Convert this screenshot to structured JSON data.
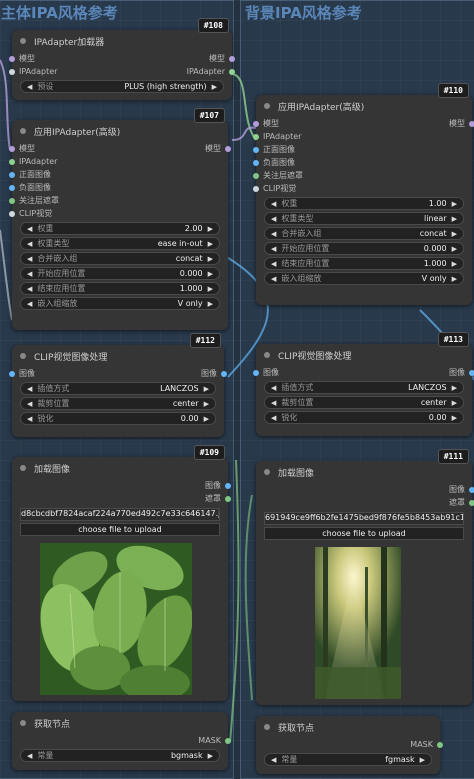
{
  "groups": {
    "left_title": "主体IPA风格参考",
    "right_title": "背景IPA风格参考"
  },
  "colors": {
    "canvas": "#243240",
    "node": "#353535",
    "group_title": "#5b86b8",
    "model_slot": "#b39ddb",
    "ipadapter_slot": "#8fd18f",
    "image_slot": "#64b5f6",
    "mask_slot": "#81c784"
  },
  "nodes": {
    "n108": {
      "badge": "#108",
      "title": "IPAdapter加载器",
      "inputs": {
        "model": "模型",
        "ipadapter": "IPAdapter"
      },
      "outputs": {
        "model": "模型",
        "ipadapter": "IPAdapter"
      },
      "widget": {
        "label": "预设",
        "value": "PLUS (high strength)"
      }
    },
    "n107": {
      "badge": "#107",
      "title": "应用IPAdapter(高级)",
      "inputs": {
        "model": "模型",
        "ipadapter": "IPAdapter",
        "pos": "正面图像",
        "neg": "负面图像",
        "mask": "关注层遮罩",
        "clip": "CLIP视觉"
      },
      "outputs": {
        "model": "模型"
      },
      "widgets": [
        {
          "label": "权重",
          "value": "2.00"
        },
        {
          "label": "权重类型",
          "value": "ease in-out"
        },
        {
          "label": "合并嵌入组",
          "value": "concat"
        },
        {
          "label": "开始应用位置",
          "value": "0.000"
        },
        {
          "label": "结束应用位置",
          "value": "1.000"
        },
        {
          "label": "嵌入组缩放",
          "value": "V only"
        }
      ]
    },
    "n110": {
      "badge": "#110",
      "title": "应用IPAdapter(高级)",
      "inputs": {
        "model": "模型",
        "ipadapter": "IPAdapter",
        "pos": "正面图像",
        "neg": "负面图像",
        "mask": "关注层遮罩",
        "clip": "CLIP视觉"
      },
      "outputs": {
        "model": "模型"
      },
      "widgets": [
        {
          "label": "权重",
          "value": "1.00"
        },
        {
          "label": "权重类型",
          "value": "linear"
        },
        {
          "label": "合并嵌入组",
          "value": "concat"
        },
        {
          "label": "开始应用位置",
          "value": "0.000"
        },
        {
          "label": "结束应用位置",
          "value": "1.000"
        },
        {
          "label": "嵌入组缩放",
          "value": "V only"
        }
      ]
    },
    "n112": {
      "badge": "#112",
      "title": "CLIP视觉图像处理",
      "input": "图像",
      "output": "图像",
      "widgets": [
        {
          "label": "插值方式",
          "value": "LANCZOS"
        },
        {
          "label": "裁剪位置",
          "value": "center"
        },
        {
          "label": "锐化",
          "value": "0.00"
        }
      ]
    },
    "n113": {
      "badge": "#113",
      "title": "CLIP视觉图像处理",
      "input": "图像",
      "output": "图像",
      "widgets": [
        {
          "label": "插值方式",
          "value": "LANCZOS"
        },
        {
          "label": "裁剪位置",
          "value": "center"
        },
        {
          "label": "锐化",
          "value": "0.00"
        }
      ]
    },
    "n109": {
      "badge": "#109",
      "title": "加载图像",
      "outputs": {
        "image": "图像",
        "mask": "遮罩"
      },
      "filename": "d8cbcdbf7824acaf224a770ed492c7e33c646147.jpg",
      "upload": "choose file to upload"
    },
    "n111": {
      "badge": "#111",
      "title": "加载图像",
      "outputs": {
        "image": "图像",
        "mask": "遮罩"
      },
      "filename": "691949ce9ff6b2fe1475bed9f876fe5b8453ab91c195f7e1d5ae0227c5c45cf.png",
      "upload": "choose file to upload"
    },
    "get_left": {
      "title": "获取节点",
      "output": "MASK",
      "widget": {
        "label": "常量",
        "value": "bgmask"
      }
    },
    "get_right": {
      "title": "获取节点",
      "output": "MASK",
      "widget": {
        "label": "常量",
        "value": "fgmask"
      }
    }
  }
}
